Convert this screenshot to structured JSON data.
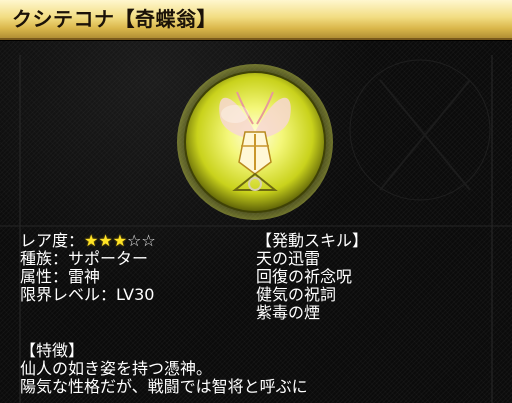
{
  "header": {
    "title": "クシテコナ【奇蝶翁】"
  },
  "portrait": {
    "icon": "butterfly-sage-emblem",
    "orb_color": "#e8f040"
  },
  "stats": {
    "rarity_label": "レア度：",
    "rarity_filled": "★★★",
    "rarity_empty": "☆☆",
    "rarity_value": 3,
    "rarity_max": 5,
    "type_line": "種族：サポーター",
    "attribute_line": "属性：雷神",
    "limit_level_line": "限界レベル：LV30"
  },
  "skills": {
    "header": "【発動スキル】",
    "items": [
      "天の迅雷",
      "回復の祈念呪",
      "健気の祝詞",
      "紫毒の煙"
    ]
  },
  "traits": {
    "header": "【特徴】",
    "lines": [
      "仙人の如き姿を持つ憑神。",
      "陽気な性格だが、戦闘では智将と呼ぶに"
    ]
  },
  "colors": {
    "title_bar": "#f2dd83",
    "star_on": "#ffe326",
    "background": "#0c0c0c"
  }
}
